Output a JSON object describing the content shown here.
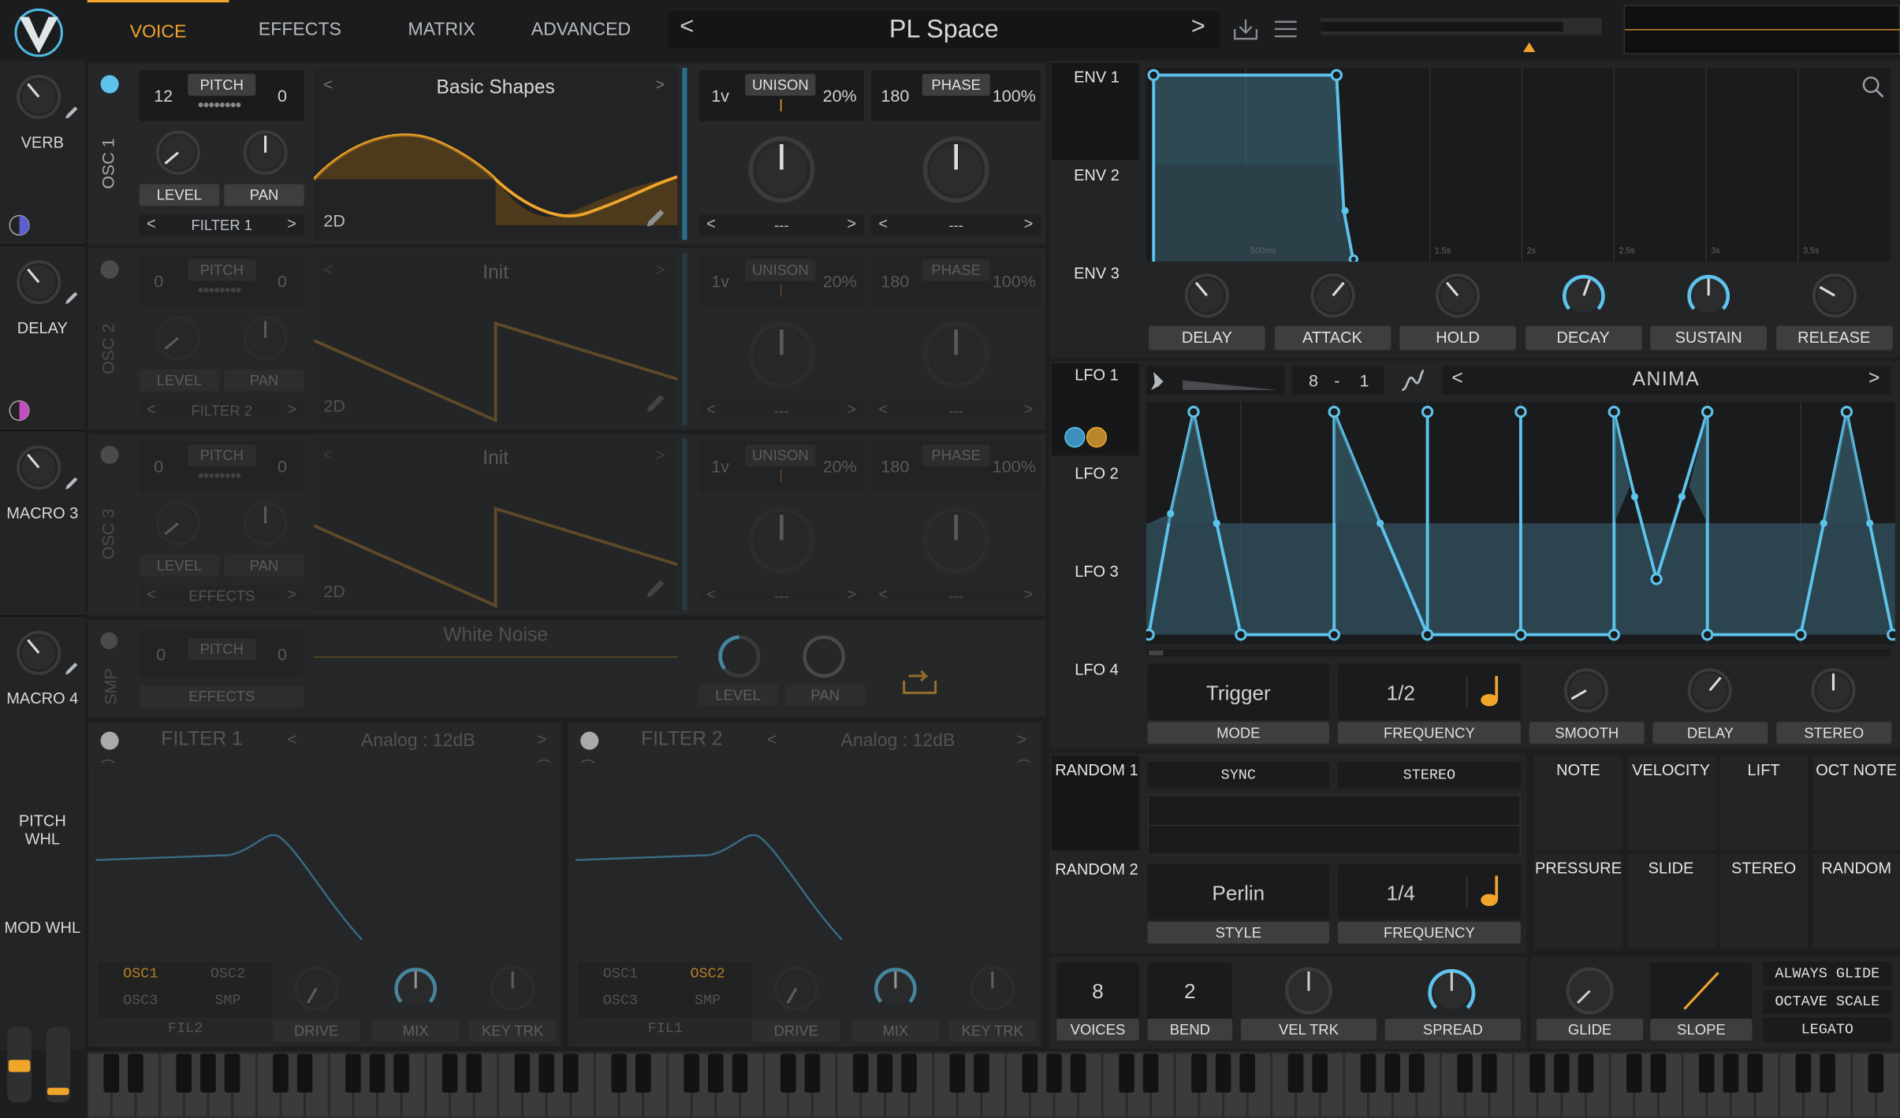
{
  "header": {
    "tabs": [
      {
        "label": "VOICE",
        "active": true
      },
      {
        "label": "EFFECTS"
      },
      {
        "label": "MATRIX"
      },
      {
        "label": "ADVANCED"
      }
    ],
    "preset_name": "PL Space",
    "prev_arrow": "<",
    "next_arrow": ">"
  },
  "macros": [
    {
      "label": "VERB"
    },
    {
      "label": "DELAY"
    },
    {
      "label": "MACRO 3"
    },
    {
      "label": "MACRO 4"
    }
  ],
  "wheels": {
    "pitch_label": "PITCH WHL",
    "mod_label": "MOD WHL"
  },
  "osc1": {
    "title": "OSC 1",
    "pitch_coarse": "12",
    "pitch_label": "PITCH",
    "pitch_fine": "0",
    "level_label": "LEVEL",
    "pan_label": "PAN",
    "filter_dest": "FILTER 1",
    "wavetable": "Basic Shapes",
    "dim_label": "2D",
    "unison_voices": "1v",
    "unison_label": "UNISON",
    "unison_detune": "20%",
    "phase_value": "180",
    "phase_label": "PHASE",
    "phase_rand": "100%",
    "unison_sel": "---",
    "phase_sel": "---"
  },
  "osc2": {
    "title": "OSC 2",
    "pitch_coarse": "0",
    "pitch_label": "PITCH",
    "pitch_fine": "0",
    "level_label": "LEVEL",
    "pan_label": "PAN",
    "filter_dest": "FILTER 2",
    "wavetable": "Init",
    "dim_label": "2D",
    "unison_voices": "1v",
    "unison_label": "UNISON",
    "unison_detune": "20%",
    "phase_value": "180",
    "phase_label": "PHASE",
    "phase_rand": "100%",
    "unison_sel": "---",
    "phase_sel": "---"
  },
  "osc3": {
    "title": "OSC 3",
    "pitch_coarse": "0",
    "pitch_label": "PITCH",
    "pitch_fine": "0",
    "level_label": "LEVEL",
    "pan_label": "PAN",
    "filter_dest": "EFFECTS",
    "wavetable": "Init",
    "dim_label": "2D",
    "unison_voices": "1v",
    "unison_label": "UNISON",
    "unison_detune": "20%",
    "phase_value": "180",
    "phase_label": "PHASE",
    "phase_rand": "100%",
    "unison_sel": "---",
    "phase_sel": "---"
  },
  "smp": {
    "title": "SMP",
    "pitch_coarse": "0",
    "pitch_label": "PITCH",
    "pitch_fine": "0",
    "dest": "EFFECTS",
    "sample": "White Noise",
    "level_label": "LEVEL",
    "pan_label": "PAN"
  },
  "filter1": {
    "title": "FILTER 1",
    "model": "Analog : 12dB",
    "src": [
      "OSC1",
      "OSC2",
      "OSC3",
      "SMP"
    ],
    "fil": "FIL2",
    "drive": "DRIVE",
    "mix": "MIX",
    "keytrk": "KEY TRK"
  },
  "filter2": {
    "title": "FILTER 2",
    "model": "Analog : 12dB",
    "src": [
      "OSC1",
      "OSC2",
      "OSC3",
      "SMP"
    ],
    "fil": "FIL1",
    "drive": "DRIVE",
    "mix": "MIX",
    "keytrk": "KEY TRK"
  },
  "env": {
    "tabs": [
      "ENV 1",
      "ENV 2",
      "ENV 3"
    ],
    "time_marks": [
      "500ms",
      "1.5s",
      "2s",
      "2.5s",
      "3s",
      "3.5s"
    ],
    "knobs": [
      "DELAY",
      "ATTACK",
      "HOLD",
      "DECAY",
      "SUSTAIN",
      "RELEASE"
    ]
  },
  "lfo": {
    "tabs": [
      "LFO 1",
      "LFO 2",
      "LFO 3",
      "LFO 4"
    ],
    "grid_x": "8",
    "grid_sep": "-",
    "grid_y": "1",
    "shape": "ANIMA",
    "mode": "Trigger",
    "mode_label": "MODE",
    "freq": "1/2",
    "freq_label": "FREQUENCY",
    "knobs": [
      "SMOOTH",
      "DELAY",
      "STEREO"
    ]
  },
  "random": {
    "tabs": [
      "RANDOM 1",
      "RANDOM 2"
    ],
    "sync": "SYNC",
    "stereo": "STEREO",
    "style": "Perlin",
    "style_label": "STYLE",
    "freq": "1/4",
    "freq_label": "FREQUENCY"
  },
  "mod_sources": [
    "NOTE",
    "VELOCITY",
    "LIFT",
    "OCT NOTE",
    "PRESSURE",
    "SLIDE",
    "STEREO",
    "RANDOM"
  ],
  "voice": {
    "voices": "8",
    "voices_label": "VOICES",
    "bend": "2",
    "bend_label": "BEND",
    "veltrk": "VEL TRK",
    "spread": "SPREAD",
    "glide": "GLIDE",
    "slope": "SLOPE",
    "always_glide": "ALWAYS GLIDE",
    "octave_scale": "OCTAVE SCALE",
    "legato": "LEGATO"
  },
  "colors": {
    "accent": "#f0a52b",
    "mod": "#5ec3ec",
    "panel": "#262728",
    "bg": "#1d1e1f"
  }
}
